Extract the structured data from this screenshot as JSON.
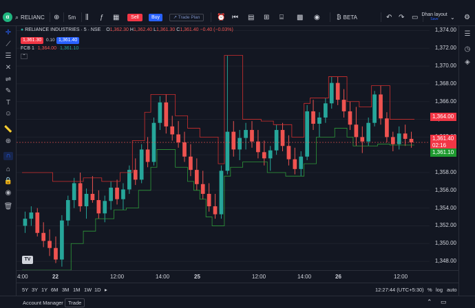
{
  "toolbar": {
    "logo": "α",
    "symbol": "RELIANC",
    "interval": "5m",
    "sell_label": "Sell",
    "buy_label": "Buy",
    "trade_plan_label": "Trade Plan",
    "beta_label": "BETA",
    "layout_label": "Dhan layout",
    "save_label": "Save"
  },
  "legend": {
    "title": "RELIANCE INDUSTRIES · 5 · NSE",
    "o_label": "O",
    "o": "1,362.30",
    "h_label": "H",
    "h": "1,362.40",
    "l_label": "L",
    "l": "1,361.30",
    "c_label": "C",
    "c": "1,361.40",
    "change": "−0.40 (−0.03%)",
    "bid": "1,361.30",
    "spread": "0.10",
    "ask": "1,361.40",
    "indicator": "FCB 1",
    "fcb_high": "1,364.00",
    "fcb_low": "1,361.10"
  },
  "price_axis": {
    "labels": [
      "1,374.00",
      "1,372.00",
      "1,370.00",
      "1,368.00",
      "1,366.00",
      "1,364.00",
      "1,362.00",
      "1,360.00",
      "1,358.00",
      "1,356.00",
      "1,354.00",
      "1,352.00",
      "1,350.00",
      "1,348.00"
    ],
    "tag_high": "1,364.00",
    "tag_last": "1,361.40",
    "tag_countdown": "02:16",
    "tag_low": "1,361.10"
  },
  "time_axis": {
    "labels": [
      "4:00",
      "22",
      "12:00",
      "14:00",
      "25",
      "12:00",
      "14:00",
      "26",
      "12:00"
    ]
  },
  "bottom": {
    "ranges": [
      "5Y",
      "3Y",
      "1Y",
      "6M",
      "3M",
      "1M",
      "1W",
      "1D"
    ],
    "clock": "12:27:44 (UTC+5:30)",
    "percent": "%",
    "log": "log",
    "auto": "auto"
  },
  "footer": {
    "account_manager": "Account Manager",
    "trade": "Trade"
  },
  "colors": {
    "up": "#26a69a",
    "down": "#ef5350",
    "fcb_high": "#d32f2f",
    "fcb_low": "#2e9c3a",
    "background": "#131722"
  },
  "chart_data": {
    "type": "candlestick",
    "ylim": [
      1347,
      1374.5
    ],
    "candles": [
      [
        1352.0,
        1353.6,
        1351.2,
        1352.8
      ],
      [
        1352.8,
        1354.2,
        1352.0,
        1353.5
      ],
      [
        1353.5,
        1354.0,
        1350.8,
        1351.2
      ],
      [
        1351.2,
        1352.4,
        1349.6,
        1350.3
      ],
      [
        1350.3,
        1351.6,
        1348.6,
        1349.5
      ],
      [
        1349.5,
        1350.8,
        1347.8,
        1348.2
      ],
      [
        1348.2,
        1353.2,
        1347.4,
        1352.6
      ],
      [
        1352.6,
        1355.4,
        1352.0,
        1354.9
      ],
      [
        1354.9,
        1357.4,
        1354.0,
        1356.8
      ],
      [
        1356.8,
        1358.0,
        1353.6,
        1354.2
      ],
      [
        1354.2,
        1356.2,
        1352.8,
        1355.6
      ],
      [
        1355.6,
        1357.6,
        1354.6,
        1354.9
      ],
      [
        1354.9,
        1356.0,
        1352.8,
        1353.4
      ],
      [
        1353.4,
        1355.4,
        1352.4,
        1354.8
      ],
      [
        1354.8,
        1357.0,
        1353.8,
        1356.3
      ],
      [
        1356.3,
        1357.2,
        1354.4,
        1355.0
      ],
      [
        1355.0,
        1356.8,
        1353.8,
        1356.1
      ],
      [
        1356.1,
        1358.8,
        1355.6,
        1358.3
      ],
      [
        1358.3,
        1359.6,
        1356.6,
        1357.2
      ],
      [
        1357.2,
        1361.2,
        1356.8,
        1360.6
      ],
      [
        1360.6,
        1362.0,
        1358.6,
        1359.2
      ],
      [
        1359.2,
        1364.2,
        1358.8,
        1363.6
      ],
      [
        1363.6,
        1366.6,
        1362.8,
        1365.9
      ],
      [
        1365.9,
        1366.8,
        1362.4,
        1363.2
      ],
      [
        1363.2,
        1364.4,
        1361.6,
        1362.3
      ],
      [
        1362.3,
        1363.8,
        1360.8,
        1361.4
      ],
      [
        1361.4,
        1362.6,
        1359.2,
        1359.8
      ],
      [
        1359.8,
        1361.2,
        1357.6,
        1358.3
      ],
      [
        1358.3,
        1359.6,
        1356.0,
        1356.7
      ],
      [
        1356.7,
        1358.2,
        1355.0,
        1355.6
      ],
      [
        1355.6,
        1356.8,
        1353.6,
        1354.2
      ],
      [
        1354.2,
        1355.6,
        1352.8,
        1353.3
      ],
      [
        1353.3,
        1358.8,
        1352.8,
        1358.2
      ],
      [
        1358.2,
        1371.2,
        1357.8,
        1362.6
      ],
      [
        1362.6,
        1363.8,
        1359.8,
        1360.6
      ],
      [
        1360.6,
        1362.8,
        1359.4,
        1361.9
      ],
      [
        1361.9,
        1363.6,
        1360.6,
        1362.8
      ],
      [
        1362.8,
        1363.8,
        1360.8,
        1361.5
      ],
      [
        1361.5,
        1362.8,
        1359.6,
        1360.3
      ],
      [
        1360.3,
        1361.6,
        1358.8,
        1359.6
      ],
      [
        1359.6,
        1361.0,
        1358.2,
        1360.5
      ],
      [
        1360.5,
        1363.4,
        1360.0,
        1362.8
      ],
      [
        1362.8,
        1363.6,
        1360.4,
        1361.0
      ],
      [
        1361.0,
        1362.2,
        1358.8,
        1359.5
      ],
      [
        1359.5,
        1360.8,
        1357.8,
        1358.4
      ],
      [
        1358.4,
        1360.4,
        1357.6,
        1359.8
      ],
      [
        1359.8,
        1365.6,
        1359.4,
        1364.9
      ],
      [
        1364.9,
        1366.2,
        1362.8,
        1363.5
      ],
      [
        1363.5,
        1364.8,
        1362.0,
        1364.2
      ],
      [
        1364.2,
        1366.4,
        1363.6,
        1365.8
      ],
      [
        1365.8,
        1368.8,
        1365.2,
        1368.1
      ],
      [
        1368.1,
        1368.8,
        1365.6,
        1366.2
      ],
      [
        1366.2,
        1367.4,
        1364.2,
        1364.9
      ],
      [
        1364.9,
        1366.0,
        1362.8,
        1363.4
      ],
      [
        1363.4,
        1365.4,
        1361.0,
        1362.0
      ],
      [
        1362.0,
        1363.2,
        1360.2,
        1361.5
      ],
      [
        1361.5,
        1364.2,
        1361.0,
        1363.6
      ],
      [
        1363.6,
        1367.2,
        1363.2,
        1366.8
      ],
      [
        1366.8,
        1367.8,
        1363.4,
        1364.1
      ],
      [
        1364.1,
        1364.8,
        1361.4,
        1362.0
      ],
      [
        1362.0,
        1362.6,
        1360.4,
        1361.2
      ],
      [
        1361.2,
        1363.2,
        1360.6,
        1362.4
      ],
      [
        1362.4,
        1363.4,
        1361.0,
        1361.8
      ],
      [
        1361.8,
        1362.6,
        1360.8,
        1361.4
      ]
    ],
    "fcb_high": [
      1358.0,
      1358.0,
      1358.0,
      1358.0,
      1358.0,
      1357.0,
      1357.0,
      1357.0,
      1357.0,
      1357.0,
      1357.4,
      1357.4,
      1357.4,
      1357.0,
      1357.0,
      1357.0,
      1358.0,
      1358.0,
      1361.6,
      1361.6,
      1364.8,
      1366.8,
      1366.8,
      1366.8,
      1366.8,
      1364.4,
      1364.4,
      1363.0,
      1363.0,
      1362.0,
      1362.0,
      1362.0,
      1359.0,
      1371.2,
      1371.2,
      1371.2,
      1364.0,
      1364.0,
      1364.0,
      1363.8,
      1363.8,
      1363.4,
      1363.4,
      1363.4,
      1362.0,
      1362.0,
      1365.8,
      1366.4,
      1366.4,
      1366.4,
      1368.8,
      1368.8,
      1368.8,
      1366.0,
      1366.0,
      1365.4,
      1365.4,
      1367.8,
      1367.8,
      1367.8,
      1364.0,
      1364.0,
      1364.0,
      1364.0
    ],
    "fcb_low": [
      1347.0,
      1347.0,
      1347.0,
      1347.0,
      1347.0,
      1347.0,
      1347.0,
      1347.0,
      1350.0,
      1350.0,
      1351.4,
      1351.4,
      1352.8,
      1352.8,
      1352.8,
      1353.8,
      1353.8,
      1354.0,
      1354.0,
      1356.0,
      1356.0,
      1358.6,
      1360.6,
      1360.6,
      1360.6,
      1358.6,
      1358.6,
      1357.0,
      1356.0,
      1355.0,
      1353.0,
      1352.0,
      1352.0,
      1357.6,
      1358.6,
      1358.6,
      1359.2,
      1359.2,
      1359.2,
      1359.2,
      1358.0,
      1358.0,
      1358.0,
      1357.6,
      1357.6,
      1357.6,
      1359.0,
      1359.0,
      1362.0,
      1362.0,
      1362.0,
      1363.0,
      1363.0,
      1362.0,
      1361.0,
      1361.0,
      1361.0,
      1361.0,
      1361.2,
      1361.2,
      1361.1,
      1361.1,
      1361.1,
      1361.1
    ]
  }
}
